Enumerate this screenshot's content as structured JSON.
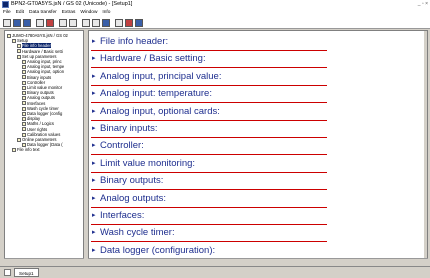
{
  "window": {
    "title": "BPN2-GT0A5YS.jsN / GS 02 (Unicode) - [Setup1]",
    "controls": "_ ▫ ×"
  },
  "menu": [
    "File",
    "Edit",
    "Data transfer",
    "Extras",
    "Window",
    "Info"
  ],
  "tree": [
    {
      "label": "JUMO-4780A5YS.jsN / GS 02",
      "depth": 0,
      "selected": false
    },
    {
      "label": "Setup",
      "depth": 1,
      "selected": false
    },
    {
      "label": "File info header",
      "depth": 2,
      "selected": true
    },
    {
      "label": "Hardware / Basic setti",
      "depth": 2,
      "selected": false
    },
    {
      "label": "Set up parameters",
      "depth": 2,
      "selected": false
    },
    {
      "label": "Analog input, princ",
      "depth": 3,
      "selected": false
    },
    {
      "label": "Analog input, tempe",
      "depth": 3,
      "selected": false
    },
    {
      "label": "Analog input, option",
      "depth": 3,
      "selected": false
    },
    {
      "label": "Binary inputs",
      "depth": 3,
      "selected": false
    },
    {
      "label": "Controller",
      "depth": 3,
      "selected": false
    },
    {
      "label": "Limit value monitor",
      "depth": 3,
      "selected": false
    },
    {
      "label": "Binary outputs",
      "depth": 3,
      "selected": false
    },
    {
      "label": "Analog outputs",
      "depth": 3,
      "selected": false
    },
    {
      "label": "Interfaces",
      "depth": 3,
      "selected": false
    },
    {
      "label": "Wash cycle timer",
      "depth": 3,
      "selected": false
    },
    {
      "label": "Data logger (config",
      "depth": 3,
      "selected": false
    },
    {
      "label": "display",
      "depth": 3,
      "selected": false
    },
    {
      "label": "Maths / Logics",
      "depth": 3,
      "selected": false
    },
    {
      "label": "User rights",
      "depth": 3,
      "selected": false
    },
    {
      "label": "Calibration values",
      "depth": 3,
      "selected": false
    },
    {
      "label": "Online parameters",
      "depth": 2,
      "selected": false
    },
    {
      "label": "Data logger (Data (",
      "depth": 3,
      "selected": false
    },
    {
      "label": "File info text",
      "depth": 1,
      "selected": false
    }
  ],
  "sections": [
    "File info header:",
    "Hardware / Basic setting:",
    "Analog input, principal value:",
    "Analog input: temperature:",
    "Analog input, optional cards:",
    "Binary inputs:",
    "Controller:",
    "Limit value monitoring:",
    "Binary outputs:",
    "Analog outputs:",
    "Interfaces:",
    "Wash cycle timer:",
    "Data logger (configuration):"
  ],
  "status": {
    "tab_label": "Setup1"
  },
  "colors": {
    "section_text": "#1f2f8f",
    "section_line": "#cc0000",
    "selection": "#0a246a"
  }
}
